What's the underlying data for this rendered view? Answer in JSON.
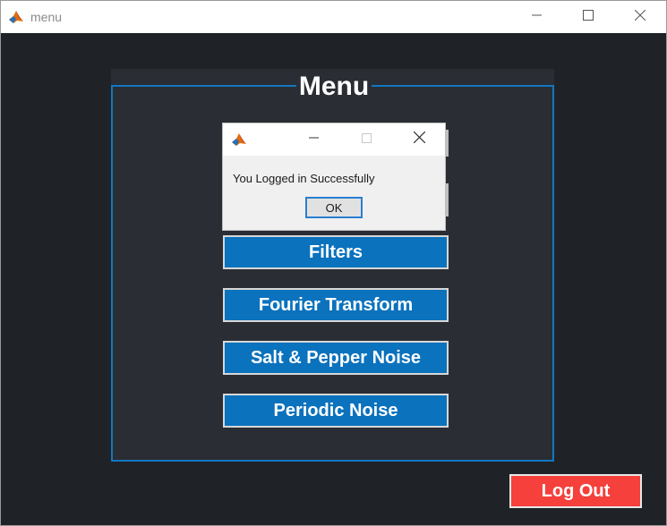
{
  "window": {
    "title": "menu",
    "icon": "matlab-icon",
    "controls": [
      "minimize-icon",
      "maximize-icon",
      "close-icon"
    ]
  },
  "menu": {
    "title": "Menu",
    "buttons": [
      {
        "label": "Filters"
      },
      {
        "label": "Fourier Transform"
      },
      {
        "label": "Salt & Pepper Noise"
      },
      {
        "label": "Periodic Noise"
      }
    ],
    "logout_label": "Log Out"
  },
  "dialog": {
    "icon": "matlab-icon",
    "message": "You Logged in Successfully",
    "ok_label": "OK"
  },
  "colors": {
    "background": "#1f2227",
    "panel": "#2a2d33",
    "panel_border": "#1377c2",
    "menu_button": "#0b72bd",
    "logout_button": "#f5403c"
  }
}
